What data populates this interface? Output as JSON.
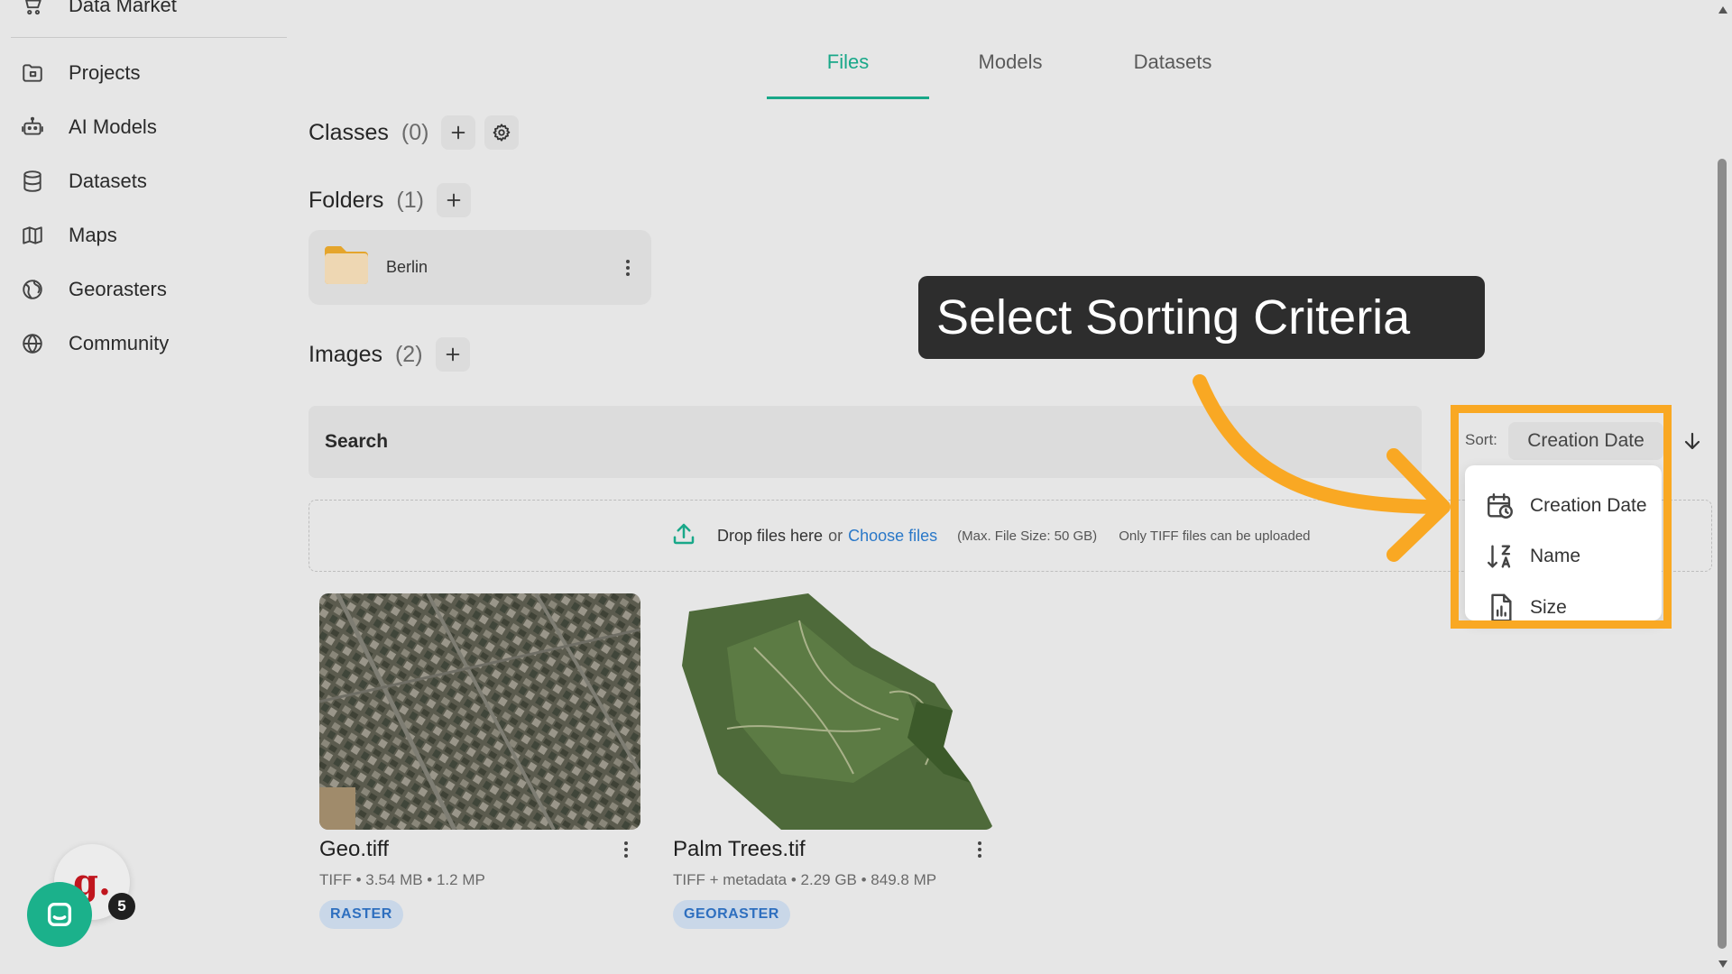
{
  "sidebar": {
    "items": [
      {
        "label": "Data Market",
        "icon": "cart-icon"
      },
      {
        "label": "Projects",
        "icon": "folder-icon"
      },
      {
        "label": "AI Models",
        "icon": "robot-icon"
      },
      {
        "label": "Datasets",
        "icon": "database-icon"
      },
      {
        "label": "Maps",
        "icon": "map-icon"
      },
      {
        "label": "Georasters",
        "icon": "globe-grid-icon"
      },
      {
        "label": "Community",
        "icon": "globe-icon"
      }
    ]
  },
  "tabs": [
    "Files",
    "Models",
    "Datasets"
  ],
  "active_tab": "Files",
  "classes": {
    "title": "Classes",
    "count": "(0)"
  },
  "folders": {
    "title": "Folders",
    "count": "(1)",
    "items": [
      {
        "name": "Berlin"
      }
    ]
  },
  "images": {
    "title": "Images",
    "count": "(2)"
  },
  "search": {
    "placeholder": "Search"
  },
  "upload": {
    "drop_text": "Drop files here",
    "or_text": "or",
    "choose_link": "Choose files",
    "max_size": "(Max. File Size: 50 GB)",
    "only_tiff": "Only TIFF files can be uploaded"
  },
  "image_cards": [
    {
      "title": "Geo.tiff",
      "meta": "TIFF • 3.54 MB • 1.2 MP",
      "badge": "RASTER"
    },
    {
      "title": "Palm Trees.tif",
      "meta": "TIFF + metadata • 2.29 GB • 849.8 MP",
      "badge": "GEORASTER"
    }
  ],
  "sort": {
    "label": "Sort:",
    "selected": "Creation Date",
    "options": [
      {
        "label": "Creation Date",
        "icon": "calendar-clock-icon"
      },
      {
        "label": "Name",
        "icon": "sort-az-icon"
      },
      {
        "label": "Size",
        "icon": "file-chart-icon"
      }
    ]
  },
  "callout": {
    "text": "Select Sorting Criteria"
  },
  "chat": {
    "brand_letter": "g.",
    "notification_count": "5"
  },
  "colors": {
    "accent": "#19a889",
    "link": "#2a78c8",
    "highlight": "#f9a823",
    "callout_bg": "#2d2d2d",
    "badge_bg": "#c9d7e8",
    "badge_text": "#2e6fbf"
  }
}
